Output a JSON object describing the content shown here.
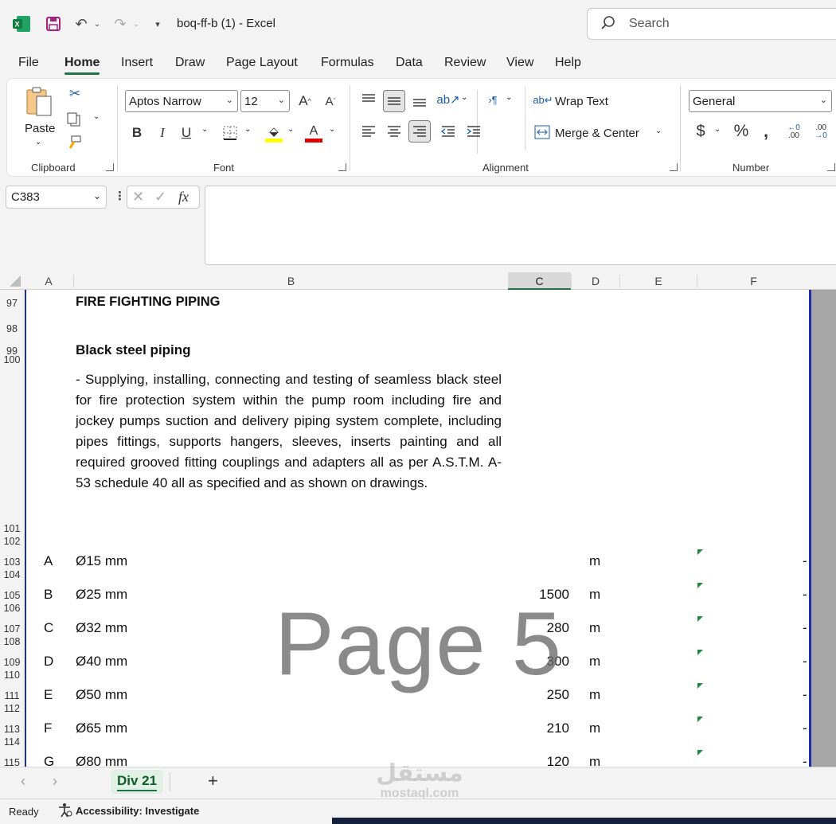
{
  "titlebar": {
    "doc_title": "boq-ff-b (1)  -  Excel",
    "search_placeholder": "Search"
  },
  "menu_tabs": [
    "File",
    "Home",
    "Insert",
    "Draw",
    "Page Layout",
    "Formulas",
    "Data",
    "Review",
    "View",
    "Help"
  ],
  "ribbon": {
    "clipboard": {
      "paste_label": "Paste",
      "group_label": "Clipboard"
    },
    "font": {
      "font_name": "Aptos Narrow",
      "font_size": "12",
      "group_label": "Font"
    },
    "alignment": {
      "wrap_text": "Wrap Text",
      "merge_center": "Merge & Center",
      "group_label": "Alignment"
    },
    "number": {
      "format": "General",
      "group_label": "Number"
    }
  },
  "formula_bar": {
    "name_box": "C383",
    "fx": "fx",
    "value": ""
  },
  "columns": [
    "A",
    "B",
    "C",
    "D",
    "E",
    "F"
  ],
  "rows": {
    "r97": "97",
    "r98": "98",
    "r99": "99",
    "r100": "100",
    "r101": "101",
    "r102": "102",
    "r103": "103",
    "r104": "104",
    "r105": "105",
    "r106": "106",
    "r107": "107",
    "r108": "108",
    "r109": "109",
    "r110": "110",
    "r111": "111",
    "r112": "112",
    "r113": "113",
    "r114": "114",
    "r115": "115"
  },
  "content": {
    "heading": "FIRE FIGHTING PIPING",
    "subheading": "Black steel piping",
    "description": "- Supplying, installing, connecting and testing of seamless black steel for fire protection system within the pump room including fire and jockey pumps suction and delivery piping system complete, including pipes fittings, supports hangers, sleeves, inserts painting and all required grooved fitting couplings and adapters all as per A.S.T.M. A-53 schedule 40 all as specified and as shown on drawings."
  },
  "items": [
    {
      "code": "A",
      "desc": "Ø15 mm",
      "qty": "",
      "unit": "m",
      "amount": "-"
    },
    {
      "code": "B",
      "desc": "Ø25 mm",
      "qty": "1500",
      "unit": "m",
      "amount": "-"
    },
    {
      "code": "C",
      "desc": "Ø32 mm",
      "qty": "280",
      "unit": "m",
      "amount": "-"
    },
    {
      "code": "D",
      "desc": "Ø40 mm",
      "qty": "300",
      "unit": "m",
      "amount": "-"
    },
    {
      "code": "E",
      "desc": "Ø50 mm",
      "qty": "250",
      "unit": "m",
      "amount": "-"
    },
    {
      "code": "F",
      "desc": "Ø65 mm",
      "qty": "210",
      "unit": "m",
      "amount": "-"
    },
    {
      "code": "G",
      "desc": "Ø80 mm",
      "qty": "120",
      "unit": "m",
      "amount": "-"
    }
  ],
  "watermark": "Page 5",
  "sheet_tab": "Div 21",
  "status": {
    "ready": "Ready",
    "accessibility": "Accessibility: Investigate"
  },
  "brand_watermark": {
    "arabic": "مستقل",
    "latin": "mostaql.com"
  },
  "colors": {
    "accent": "#217346",
    "page_border": "#1c2fa8",
    "triangle": "#1e8a3e"
  }
}
